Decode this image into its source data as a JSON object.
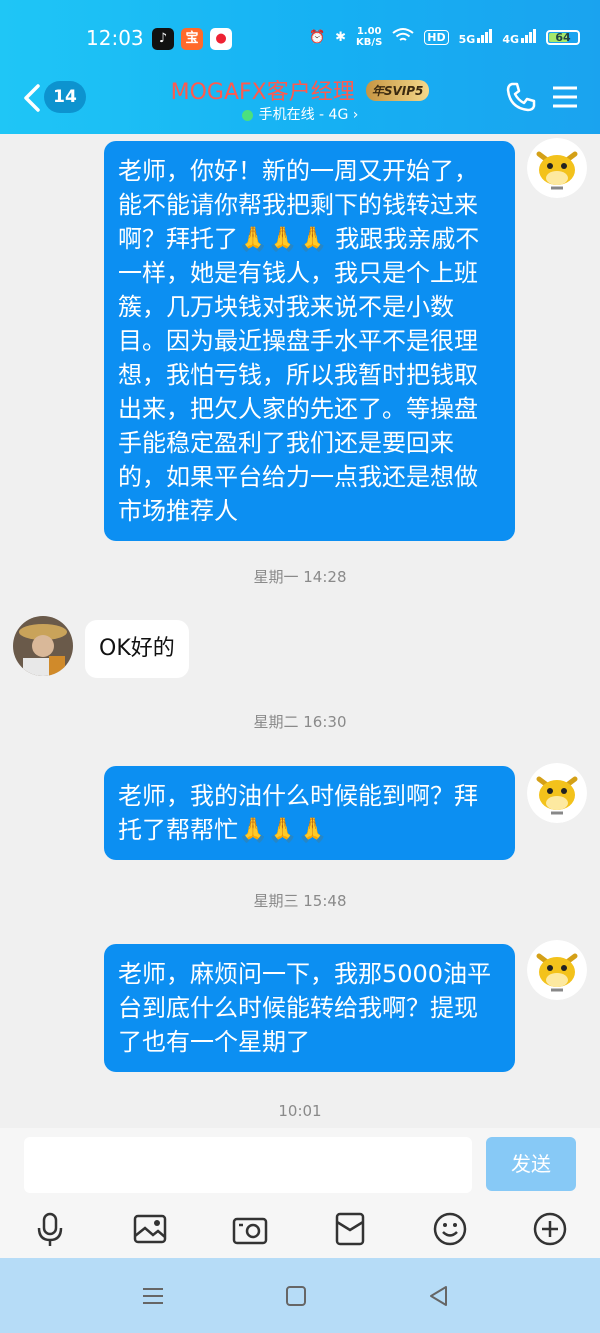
{
  "status_bar": {
    "time": "12:03",
    "net_speed": "1.00",
    "net_unit": "KB/S",
    "hd_label": "HD",
    "sim1": "5G",
    "sim2": "4G",
    "battery": "64",
    "battery_level": 64
  },
  "header": {
    "unread_count": "14",
    "title": "MOGAFX客户经理",
    "vip_badge": "年SVIP5",
    "subtitle": "手机在线 - 4G",
    "subtitle_arrow": "›"
  },
  "messages": [
    {
      "text": "老师，你好！新的一周又开始了，能不能请你帮我把剩下的钱转过来啊？拜托了🙏🙏🙏 我跟我亲戚不一样，她是有钱人，我只是个上班簇，几万块钱对我来说不是小数目。因为最近操盘手水平不是很理想，我怕亏钱，所以我暂时把钱取出来，把欠人家的先还了。等操盘手能稳定盈利了我们还是要回来的，如果平台给力一点我还是想做市场推荐人"
    },
    {
      "text": "OK好的"
    },
    {
      "text": "老师，我的油什么时候能到啊？拜托了帮帮忙🙏🙏🙏"
    },
    {
      "text": "老师，麻烦问一下，我那5000油平台到底什么时候能转给我啊？提现了也有一个星期了"
    }
  ],
  "timestamps": [
    "星期一 14:28",
    "星期二 16:30",
    "星期三 15:48",
    "10:01"
  ],
  "input": {
    "value": "",
    "send_label": "发送"
  },
  "toolbar": [
    "mic-icon",
    "image-icon",
    "camera-icon",
    "file-icon",
    "emoji-icon",
    "plus-icon"
  ],
  "nav": [
    "menu-icon",
    "home-icon",
    "back-icon"
  ]
}
